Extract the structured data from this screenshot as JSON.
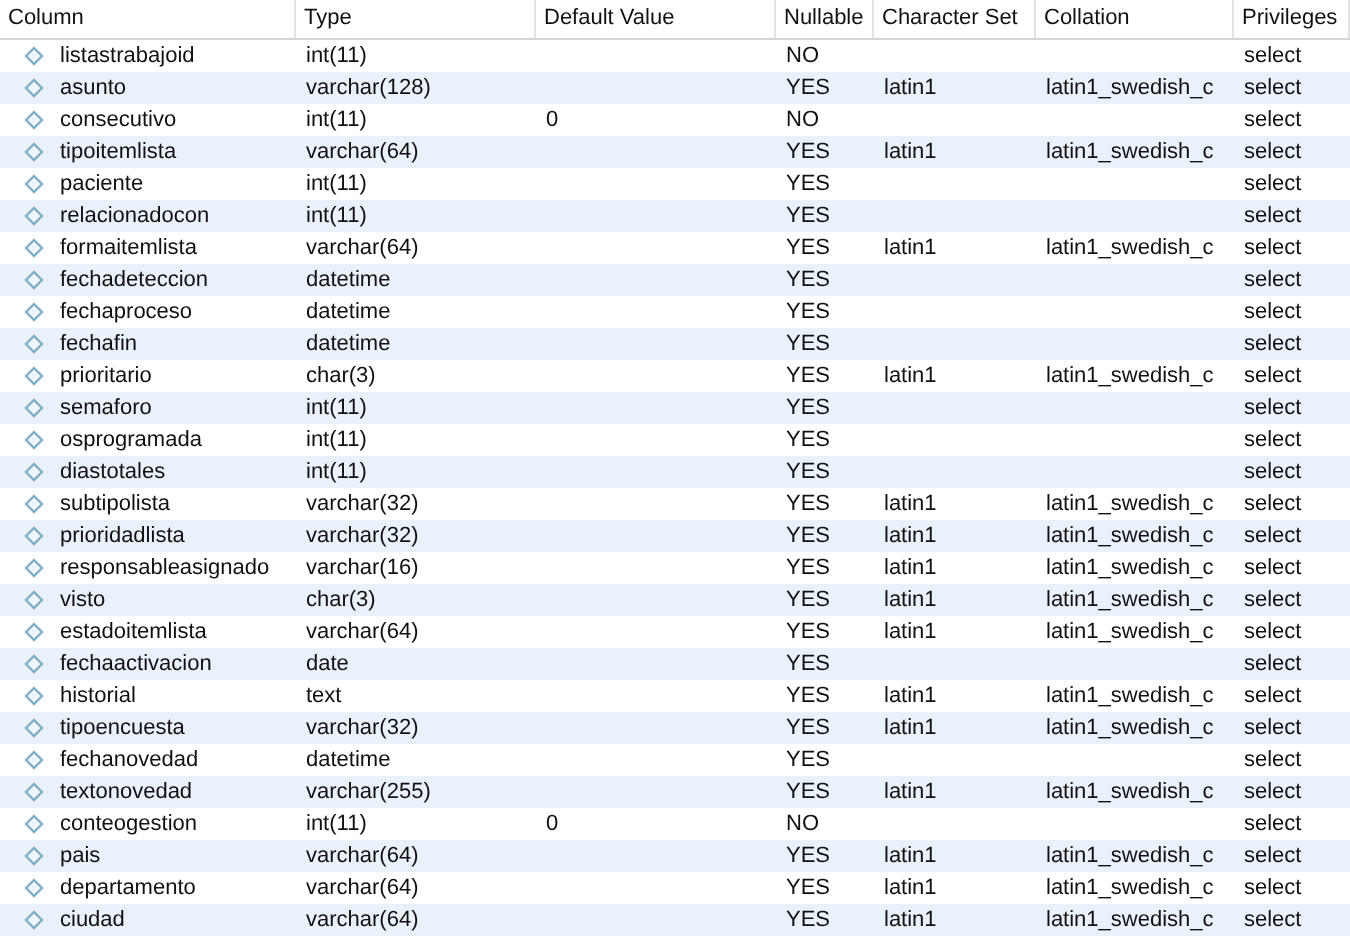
{
  "columns": [
    "Column",
    "Type",
    "Default Value",
    "Nullable",
    "Character Set",
    "Collation",
    "Privileges"
  ],
  "rows": [
    {
      "column": "listastrabajoid",
      "type": "int(11)",
      "default": "",
      "nullable": "NO",
      "charset": "",
      "collation": "",
      "privileges": "select"
    },
    {
      "column": "asunto",
      "type": "varchar(128)",
      "default": "",
      "nullable": "YES",
      "charset": "latin1",
      "collation": "latin1_swedish_c",
      "privileges": "select"
    },
    {
      "column": "consecutivo",
      "type": "int(11)",
      "default": "0",
      "nullable": "NO",
      "charset": "",
      "collation": "",
      "privileges": "select"
    },
    {
      "column": "tipoitemlista",
      "type": "varchar(64)",
      "default": "",
      "nullable": "YES",
      "charset": "latin1",
      "collation": "latin1_swedish_c",
      "privileges": "select"
    },
    {
      "column": "paciente",
      "type": "int(11)",
      "default": "",
      "nullable": "YES",
      "charset": "",
      "collation": "",
      "privileges": "select"
    },
    {
      "column": "relacionadocon",
      "type": "int(11)",
      "default": "",
      "nullable": "YES",
      "charset": "",
      "collation": "",
      "privileges": "select"
    },
    {
      "column": "formaitemlista",
      "type": "varchar(64)",
      "default": "",
      "nullable": "YES",
      "charset": "latin1",
      "collation": "latin1_swedish_c",
      "privileges": "select"
    },
    {
      "column": "fechadeteccion",
      "type": "datetime",
      "default": "",
      "nullable": "YES",
      "charset": "",
      "collation": "",
      "privileges": "select"
    },
    {
      "column": "fechaproceso",
      "type": "datetime",
      "default": "",
      "nullable": "YES",
      "charset": "",
      "collation": "",
      "privileges": "select"
    },
    {
      "column": "fechafin",
      "type": "datetime",
      "default": "",
      "nullable": "YES",
      "charset": "",
      "collation": "",
      "privileges": "select"
    },
    {
      "column": "prioritario",
      "type": "char(3)",
      "default": "",
      "nullable": "YES",
      "charset": "latin1",
      "collation": "latin1_swedish_c",
      "privileges": "select"
    },
    {
      "column": "semaforo",
      "type": "int(11)",
      "default": "",
      "nullable": "YES",
      "charset": "",
      "collation": "",
      "privileges": "select"
    },
    {
      "column": "osprogramada",
      "type": "int(11)",
      "default": "",
      "nullable": "YES",
      "charset": "",
      "collation": "",
      "privileges": "select"
    },
    {
      "column": "diastotales",
      "type": "int(11)",
      "default": "",
      "nullable": "YES",
      "charset": "",
      "collation": "",
      "privileges": "select"
    },
    {
      "column": "subtipolista",
      "type": "varchar(32)",
      "default": "",
      "nullable": "YES",
      "charset": "latin1",
      "collation": "latin1_swedish_c",
      "privileges": "select"
    },
    {
      "column": "prioridadlista",
      "type": "varchar(32)",
      "default": "",
      "nullable": "YES",
      "charset": "latin1",
      "collation": "latin1_swedish_c",
      "privileges": "select"
    },
    {
      "column": "responsableasignado",
      "type": "varchar(16)",
      "default": "",
      "nullable": "YES",
      "charset": "latin1",
      "collation": "latin1_swedish_c",
      "privileges": "select"
    },
    {
      "column": "visto",
      "type": "char(3)",
      "default": "",
      "nullable": "YES",
      "charset": "latin1",
      "collation": "latin1_swedish_c",
      "privileges": "select"
    },
    {
      "column": "estadoitemlista",
      "type": "varchar(64)",
      "default": "",
      "nullable": "YES",
      "charset": "latin1",
      "collation": "latin1_swedish_c",
      "privileges": "select"
    },
    {
      "column": "fechaactivacion",
      "type": "date",
      "default": "",
      "nullable": "YES",
      "charset": "",
      "collation": "",
      "privileges": "select"
    },
    {
      "column": "historial",
      "type": "text",
      "default": "",
      "nullable": "YES",
      "charset": "latin1",
      "collation": "latin1_swedish_c",
      "privileges": "select"
    },
    {
      "column": "tipoencuesta",
      "type": "varchar(32)",
      "default": "",
      "nullable": "YES",
      "charset": "latin1",
      "collation": "latin1_swedish_c",
      "privileges": "select"
    },
    {
      "column": "fechanovedad",
      "type": "datetime",
      "default": "",
      "nullable": "YES",
      "charset": "",
      "collation": "",
      "privileges": "select"
    },
    {
      "column": "textonovedad",
      "type": "varchar(255)",
      "default": "",
      "nullable": "YES",
      "charset": "latin1",
      "collation": "latin1_swedish_c",
      "privileges": "select"
    },
    {
      "column": "conteogestion",
      "type": "int(11)",
      "default": "0",
      "nullable": "NO",
      "charset": "",
      "collation": "",
      "privileges": "select"
    },
    {
      "column": "pais",
      "type": "varchar(64)",
      "default": "",
      "nullable": "YES",
      "charset": "latin1",
      "collation": "latin1_swedish_c",
      "privileges": "select"
    },
    {
      "column": "departamento",
      "type": "varchar(64)",
      "default": "",
      "nullable": "YES",
      "charset": "latin1",
      "collation": "latin1_swedish_c",
      "privileges": "select"
    },
    {
      "column": "ciudad",
      "type": "varchar(64)",
      "default": "",
      "nullable": "YES",
      "charset": "latin1",
      "collation": "latin1_swedish_c",
      "privileges": "select"
    }
  ]
}
